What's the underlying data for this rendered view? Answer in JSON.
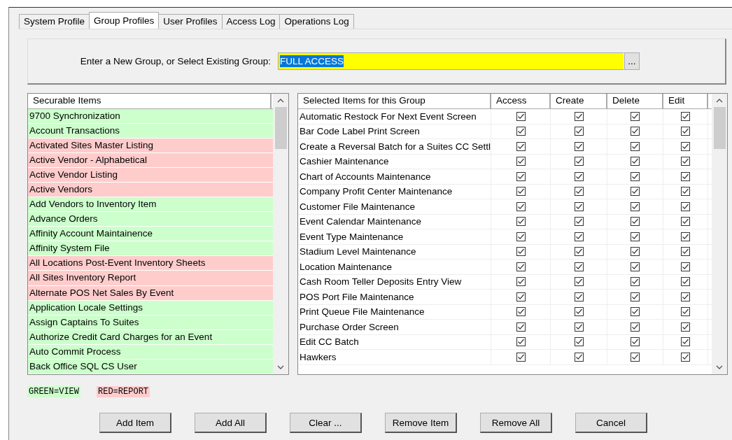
{
  "tabs": [
    {
      "label": "System Profile",
      "selected": false
    },
    {
      "label": "Group Profiles",
      "selected": true
    },
    {
      "label": "User Profiles",
      "selected": false
    },
    {
      "label": "Access Log",
      "selected": false
    },
    {
      "label": "Operations Log",
      "selected": false
    }
  ],
  "group_field": {
    "label": "Enter a New Group, or Select Existing Group:",
    "value": "FULL ACCESS",
    "browse_button": "..."
  },
  "securable_items": {
    "column": "Securable Items",
    "items": [
      {
        "label": "9700 Synchronization",
        "color": "#ccffcc"
      },
      {
        "label": "Account Transactions",
        "color": "#ccffcc"
      },
      {
        "label": "Activated Sites Master Listing",
        "color": "#ffcccc"
      },
      {
        "label": "Active Vendor - Alphabetical",
        "color": "#ffcccc"
      },
      {
        "label": "Active Vendor Listing",
        "color": "#ffcccc"
      },
      {
        "label": "Active Vendors",
        "color": "#ffcccc"
      },
      {
        "label": "Add Vendors to Inventory Item",
        "color": "#ccffcc"
      },
      {
        "label": "Advance Orders",
        "color": "#ccffcc"
      },
      {
        "label": "Affinity Account Maintainence",
        "color": "#ccffcc"
      },
      {
        "label": "Affinity System File",
        "color": "#ccffcc"
      },
      {
        "label": "All Locations Post-Event Inventory Sheets",
        "color": "#ffcccc"
      },
      {
        "label": "All Sites Inventory Report",
        "color": "#ffcccc"
      },
      {
        "label": "Alternate POS Net Sales By Event",
        "color": "#ffcccc"
      },
      {
        "label": "Application Locale Settings",
        "color": "#ccffcc"
      },
      {
        "label": "Assign Captains To Suites",
        "color": "#ccffcc"
      },
      {
        "label": "Authorize Credit Card Charges for an Event",
        "color": "#ccffcc"
      },
      {
        "label": "Auto Commit Process",
        "color": "#ccffcc"
      },
      {
        "label": "Back Office SQL CS User",
        "color": "#ccffcc"
      }
    ]
  },
  "selected_items": {
    "columns": [
      "Selected Items for this Group",
      "Access",
      "Create",
      "Delete",
      "Edit"
    ],
    "rows": [
      {
        "name": "Automatic Restock For Next Event Screen",
        "access": true,
        "create": true,
        "delete": true,
        "edit": true
      },
      {
        "name": "Bar Code Label Print Screen",
        "access": true,
        "create": true,
        "delete": true,
        "edit": true
      },
      {
        "name": "Create a Reversal Batch for a Suites CC Settl",
        "access": true,
        "create": true,
        "delete": true,
        "edit": true
      },
      {
        "name": "Cashier Maintenance",
        "access": true,
        "create": true,
        "delete": true,
        "edit": true
      },
      {
        "name": "Chart of Accounts Maintenance",
        "access": true,
        "create": true,
        "delete": true,
        "edit": true
      },
      {
        "name": "Company Profit Center Maintenance",
        "access": true,
        "create": true,
        "delete": true,
        "edit": true
      },
      {
        "name": "Customer File Maintenance",
        "access": true,
        "create": true,
        "delete": true,
        "edit": true
      },
      {
        "name": "Event Calendar Maintenance",
        "access": true,
        "create": true,
        "delete": true,
        "edit": true
      },
      {
        "name": "Event Type Maintenance",
        "access": true,
        "create": true,
        "delete": true,
        "edit": true
      },
      {
        "name": "Stadium Level Maintenance",
        "access": true,
        "create": true,
        "delete": true,
        "edit": true
      },
      {
        "name": "Location Maintenance",
        "access": true,
        "create": true,
        "delete": true,
        "edit": true
      },
      {
        "name": "Cash Room Teller Deposits Entry View",
        "access": true,
        "create": true,
        "delete": true,
        "edit": true
      },
      {
        "name": "POS Port File Maintenance",
        "access": true,
        "create": true,
        "delete": true,
        "edit": true
      },
      {
        "name": "Print Queue File Maintenance",
        "access": true,
        "create": true,
        "delete": true,
        "edit": true
      },
      {
        "name": "Purchase Order Screen",
        "access": true,
        "create": true,
        "delete": true,
        "edit": true
      },
      {
        "name": "Edit CC Batch",
        "access": true,
        "create": true,
        "delete": true,
        "edit": true
      },
      {
        "name": "Hawkers",
        "access": true,
        "create": true,
        "delete": true,
        "edit": true
      }
    ]
  },
  "legend": [
    {
      "label": "GREEN=VIEW",
      "color": "#ccffcc"
    },
    {
      "label": "RED=REPORT",
      "color": "#ffcccc"
    }
  ],
  "buttons": [
    "Add Item",
    "Add All",
    "Clear ...",
    "Remove Item",
    "Remove All",
    "Cancel"
  ]
}
